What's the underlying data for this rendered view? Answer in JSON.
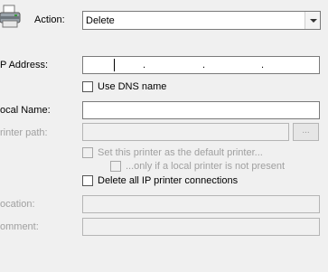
{
  "action": {
    "label": "Action:",
    "value": "Delete"
  },
  "ip_address": {
    "label": "P Address:",
    "separator": "."
  },
  "dns": {
    "label": "Use DNS name",
    "checked": false
  },
  "local_name": {
    "label": "ocal Name:",
    "value": ""
  },
  "printer_path": {
    "label": "rinter path:",
    "value": "",
    "browse_label": "..."
  },
  "default_printer": {
    "label": "Set this printer as the default printer...",
    "checked": false
  },
  "only_if_local": {
    "label": "...only if a local printer is not present",
    "checked": false
  },
  "delete_all": {
    "label": "Delete all IP printer connections",
    "checked": false
  },
  "location": {
    "label": "ocation:",
    "value": ""
  },
  "comment": {
    "label": "omment:",
    "value": ""
  }
}
